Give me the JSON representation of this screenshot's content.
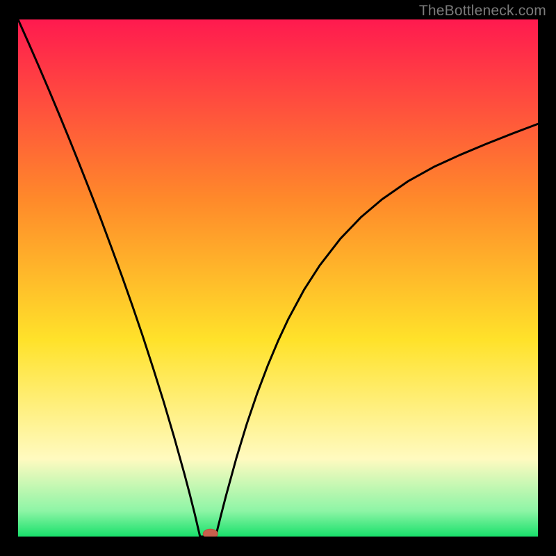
{
  "watermark": "TheBottleneck.com",
  "colors": {
    "gradient_top": "#ff1a4f",
    "gradient_mid_upper": "#ff8a2a",
    "gradient_mid": "#ffe22a",
    "gradient_lower": "#fffac0",
    "gradient_bottom_light": "#8ef5a6",
    "gradient_bottom": "#18e06b",
    "curve": "#000000",
    "marker_fill": "#c9604d",
    "marker_stroke": "#b94f3d",
    "frame": "#000000"
  },
  "chart_data": {
    "type": "line",
    "title": "",
    "xlabel": "",
    "ylabel": "",
    "xlim": [
      0,
      100
    ],
    "ylim": [
      0,
      100
    ],
    "legend": false,
    "grid": false,
    "series": [
      {
        "name": "bottleneck-curve",
        "x": [
          0,
          2,
          4,
          6,
          8,
          10,
          12,
          14,
          16,
          18,
          20,
          22,
          24,
          26,
          28,
          30,
          32,
          33,
          34,
          35,
          36,
          37,
          38,
          39,
          40,
          42,
          44,
          46,
          48,
          50,
          52,
          55,
          58,
          62,
          66,
          70,
          75,
          80,
          85,
          90,
          95,
          100
        ],
        "y": [
          100,
          95.5,
          90.9,
          86.2,
          81.4,
          76.5,
          71.5,
          66.4,
          61.2,
          55.8,
          50.3,
          44.6,
          38.7,
          32.5,
          26.1,
          19.3,
          12.1,
          8.3,
          4.3,
          0,
          0,
          0,
          0,
          4.0,
          7.9,
          15.2,
          21.8,
          27.7,
          33.0,
          37.8,
          42.1,
          47.7,
          52.4,
          57.6,
          61.8,
          65.2,
          68.7,
          71.5,
          73.8,
          75.9,
          77.9,
          79.8
        ]
      }
    ],
    "marker": {
      "x": 37,
      "y": 0,
      "rx": 1.4,
      "ry": 0.9
    },
    "annotations": []
  }
}
